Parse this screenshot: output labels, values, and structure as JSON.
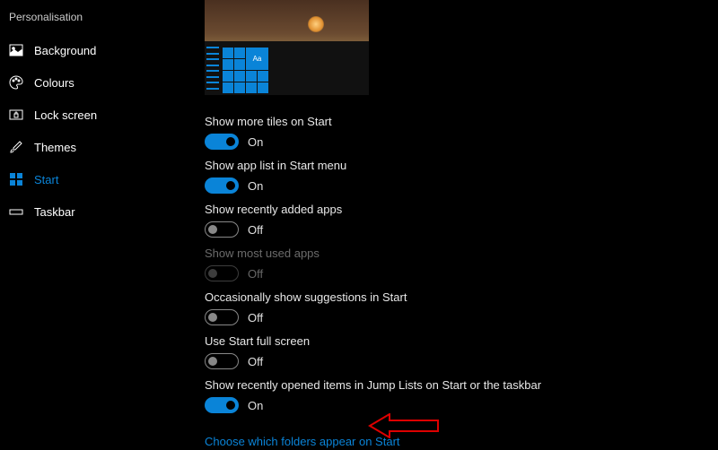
{
  "sidebar": {
    "heading": "Personalisation",
    "items": [
      {
        "label": "Background"
      },
      {
        "label": "Colours"
      },
      {
        "label": "Lock screen"
      },
      {
        "label": "Themes"
      },
      {
        "label": "Start"
      },
      {
        "label": "Taskbar"
      }
    ],
    "active_index": 4
  },
  "preview": {
    "tile_text": "Aa"
  },
  "settings": [
    {
      "label": "Show more tiles on Start",
      "state": "On",
      "on": true,
      "disabled": false
    },
    {
      "label": "Show app list in Start menu",
      "state": "On",
      "on": true,
      "disabled": false
    },
    {
      "label": "Show recently added apps",
      "state": "Off",
      "on": false,
      "disabled": false
    },
    {
      "label": "Show most used apps",
      "state": "Off",
      "on": false,
      "disabled": true
    },
    {
      "label": "Occasionally show suggestions in Start",
      "state": "Off",
      "on": false,
      "disabled": false
    },
    {
      "label": "Use Start full screen",
      "state": "Off",
      "on": false,
      "disabled": false
    },
    {
      "label": "Show recently opened items in Jump Lists on Start or the taskbar",
      "state": "On",
      "on": true,
      "disabled": false
    }
  ],
  "link": "Choose which folders appear on Start",
  "colors": {
    "accent": "#0a84d8"
  }
}
